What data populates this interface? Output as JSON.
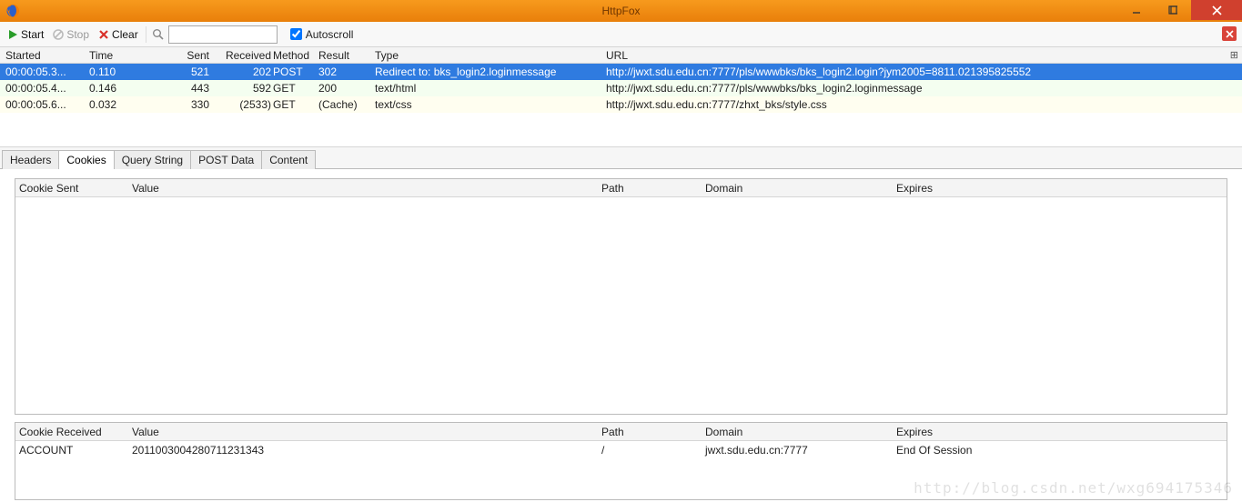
{
  "window": {
    "title": "HttpFox"
  },
  "toolbar": {
    "start": "Start",
    "stop": "Stop",
    "clear": "Clear",
    "autoscroll_label": "Autoscroll",
    "autoscroll_checked": true
  },
  "requests": {
    "columns": {
      "started": "Started",
      "time": "Time",
      "sent": "Sent",
      "received": "Received",
      "method": "Method",
      "result": "Result",
      "type": "Type",
      "url": "URL"
    },
    "rows": [
      {
        "started": "00:00:05.3...",
        "time": "0.110",
        "sent": "521",
        "received": "202",
        "method": "POST",
        "result": "302",
        "type": "Redirect to: bks_login2.loginmessage",
        "url": "http://jwxt.sdu.edu.cn:7777/pls/wwwbks/bks_login2.login?jym2005=8811.021395825552"
      },
      {
        "started": "00:00:05.4...",
        "time": "0.146",
        "sent": "443",
        "received": "592",
        "method": "GET",
        "result": "200",
        "type": "text/html",
        "url": "http://jwxt.sdu.edu.cn:7777/pls/wwwbks/bks_login2.loginmessage"
      },
      {
        "started": "00:00:05.6...",
        "time": "0.032",
        "sent": "330",
        "received": "(2533)",
        "method": "GET",
        "result": "(Cache)",
        "type": "text/css",
        "url": "http://jwxt.sdu.edu.cn:7777/zhxt_bks/style.css"
      }
    ]
  },
  "tabs": {
    "items": [
      "Headers",
      "Cookies",
      "Query String",
      "POST Data",
      "Content"
    ],
    "active_index": 1
  },
  "cookies": {
    "sent_header": {
      "name": "Cookie Sent",
      "value": "Value",
      "path": "Path",
      "domain": "Domain",
      "expires": "Expires"
    },
    "sent_rows": [],
    "recv_header": {
      "name": "Cookie Received",
      "value": "Value",
      "path": "Path",
      "domain": "Domain",
      "expires": "Expires"
    },
    "recv_rows": [
      {
        "name": "ACCOUNT",
        "value": "2011003004280711231343",
        "path": "/",
        "domain": "jwxt.sdu.edu.cn:7777",
        "expires": "End Of Session"
      }
    ]
  },
  "watermark": "http://blog.csdn.net/wxg694175346"
}
